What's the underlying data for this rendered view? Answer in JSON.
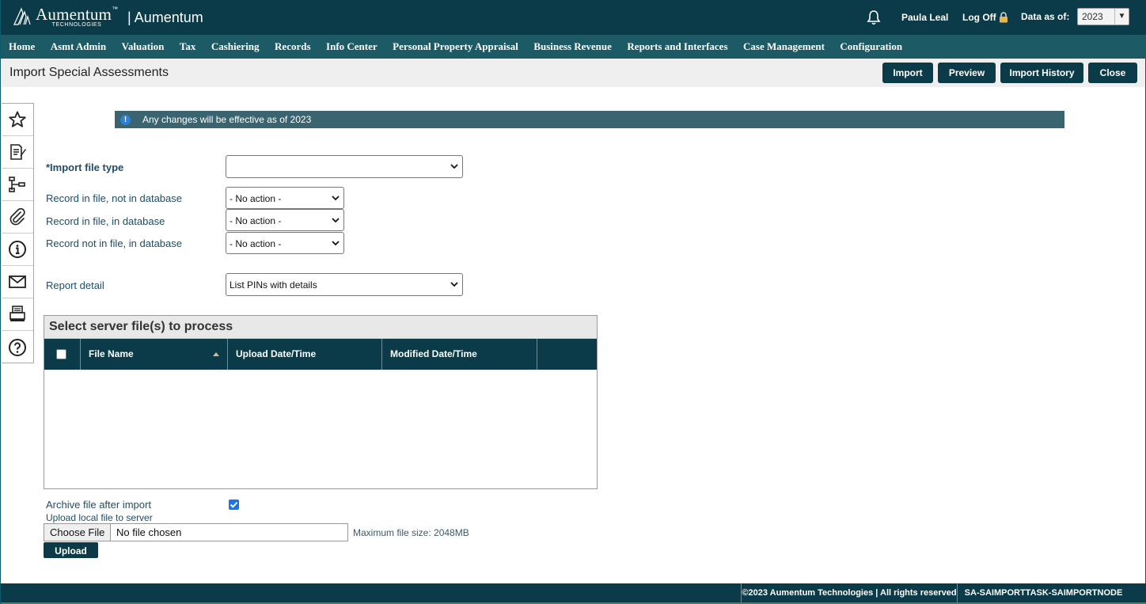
{
  "header": {
    "logo_text": "Aumentum",
    "logo_sub": "TECHNOLOGIES",
    "logo_tm": "™",
    "app_name": "| Aumentum",
    "user": "Paula Leal",
    "logoff": "Log Off",
    "data_as_of_label": "Data as of:",
    "data_as_of_value": "2023"
  },
  "nav": [
    "Home",
    "Asmt Admin",
    "Valuation",
    "Tax",
    "Cashiering",
    "Records",
    "Info Center",
    "Personal Property Appraisal",
    "Business Revenue",
    "Reports and Interfaces",
    "Case Management",
    "Configuration"
  ],
  "titlebar": {
    "title": "Import Special Assessments",
    "buttons": [
      "Import",
      "Preview",
      "Import History",
      "Close"
    ]
  },
  "sidebar": [
    "star-icon",
    "edit-document-icon",
    "hierarchy-icon",
    "paperclip-icon",
    "info-icon",
    "mail-icon",
    "print-icon",
    "help-icon"
  ],
  "banner": {
    "icon": "!",
    "text": "Any changes will be effective as of 2023"
  },
  "form": {
    "import_file_type": {
      "label": "*Import file type",
      "value": ""
    },
    "record_in_file_not_db": {
      "label": "Record in file, not in database",
      "value": "- No action -"
    },
    "record_in_file_in_db": {
      "label": "Record in file, in database",
      "value": "- No action -"
    },
    "record_not_in_file_in_db": {
      "label": "Record not in file, in database",
      "value": "- No action -"
    },
    "report_detail": {
      "label": "Report detail",
      "value": "List PINs with details"
    }
  },
  "grid": {
    "caption": "Select server file(s) to process",
    "columns": [
      "File Name",
      "Upload Date/Time",
      "Modified Date/Time"
    ],
    "rows": []
  },
  "upload": {
    "archive_label": "Archive file after import",
    "archive_checked": true,
    "upload_local_label": "Upload local file to server",
    "choose_label": "Choose File",
    "no_file_text": "No file chosen",
    "max_size": "Maximum file size: 2048MB",
    "upload_button": "Upload"
  },
  "footer": {
    "copyright": "©2023 Aumentum Technologies | All rights reserved",
    "task": "SA-SAIMPORTTASK-SAIMPORTNODE"
  },
  "colors": {
    "header_bg": "#0b3b48",
    "nav_bg": "#1c5a66",
    "banner_bg": "#3a6570",
    "label_text": "#1f4c66"
  }
}
